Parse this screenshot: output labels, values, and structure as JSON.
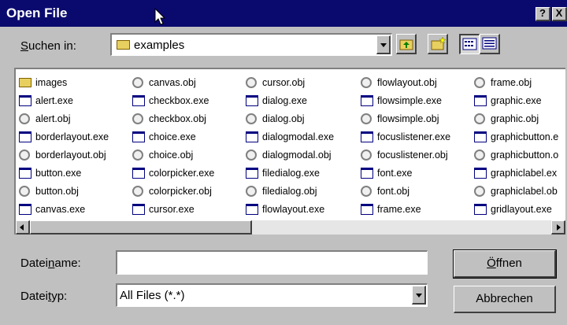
{
  "window": {
    "title": "Open File",
    "help_label": "?",
    "close_label": "X"
  },
  "lookin": {
    "label_pre": "",
    "label_accel": "S",
    "label_post": "uchen in:",
    "value": "examples"
  },
  "files": {
    "columns": [
      [
        {
          "name": "images",
          "type": "folder"
        },
        {
          "name": "alert.exe",
          "type": "exe"
        },
        {
          "name": "alert.obj",
          "type": "obj"
        },
        {
          "name": "borderlayout.exe",
          "type": "exe"
        },
        {
          "name": "borderlayout.obj",
          "type": "obj"
        },
        {
          "name": "button.exe",
          "type": "exe"
        },
        {
          "name": "button.obj",
          "type": "obj"
        },
        {
          "name": "canvas.exe",
          "type": "exe"
        }
      ],
      [
        {
          "name": "canvas.obj",
          "type": "obj"
        },
        {
          "name": "checkbox.exe",
          "type": "exe"
        },
        {
          "name": "checkbox.obj",
          "type": "obj"
        },
        {
          "name": "choice.exe",
          "type": "exe"
        },
        {
          "name": "choice.obj",
          "type": "obj"
        },
        {
          "name": "colorpicker.exe",
          "type": "exe"
        },
        {
          "name": "colorpicker.obj",
          "type": "obj"
        },
        {
          "name": "cursor.exe",
          "type": "exe"
        }
      ],
      [
        {
          "name": "cursor.obj",
          "type": "obj"
        },
        {
          "name": "dialog.exe",
          "type": "exe"
        },
        {
          "name": "dialog.obj",
          "type": "obj"
        },
        {
          "name": "dialogmodal.exe",
          "type": "exe"
        },
        {
          "name": "dialogmodal.obj",
          "type": "obj"
        },
        {
          "name": "filedialog.exe",
          "type": "exe"
        },
        {
          "name": "filedialog.obj",
          "type": "obj"
        },
        {
          "name": "flowlayout.exe",
          "type": "exe"
        }
      ],
      [
        {
          "name": "flowlayout.obj",
          "type": "obj"
        },
        {
          "name": "flowsimple.exe",
          "type": "exe"
        },
        {
          "name": "flowsimple.obj",
          "type": "obj"
        },
        {
          "name": "focuslistener.exe",
          "type": "exe"
        },
        {
          "name": "focuslistener.obj",
          "type": "obj"
        },
        {
          "name": "font.exe",
          "type": "exe"
        },
        {
          "name": "font.obj",
          "type": "obj"
        },
        {
          "name": "frame.exe",
          "type": "exe"
        }
      ],
      [
        {
          "name": "frame.obj",
          "type": "obj"
        },
        {
          "name": "graphic.exe",
          "type": "exe"
        },
        {
          "name": "graphic.obj",
          "type": "obj"
        },
        {
          "name": "graphicbutton.e",
          "type": "exe"
        },
        {
          "name": "graphicbutton.o",
          "type": "obj"
        },
        {
          "name": "graphiclabel.ex",
          "type": "exe"
        },
        {
          "name": "graphiclabel.ob",
          "type": "obj"
        },
        {
          "name": "gridlayout.exe",
          "type": "exe"
        }
      ]
    ]
  },
  "filename": {
    "label_pre": "Datei",
    "label_accel": "n",
    "label_post": "ame:",
    "value": ""
  },
  "filetype": {
    "label_pre": "Datei",
    "label_accel": "t",
    "label_post": "yp:",
    "value": "All Files (*.*)"
  },
  "buttons": {
    "open_pre": "",
    "open_accel": "Ö",
    "open_post": "ffnen",
    "cancel": "Abbrechen"
  },
  "colors": {
    "titlebar": "#0a0a6e",
    "face": "#c0c0c0"
  }
}
